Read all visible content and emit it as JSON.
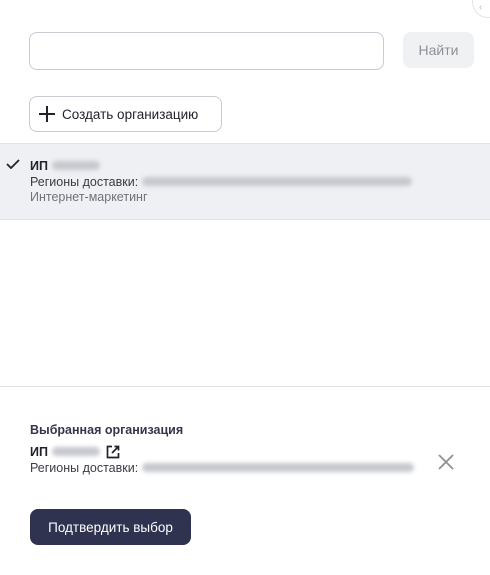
{
  "search": {
    "value": "",
    "placeholder": "",
    "button_label": "Найти"
  },
  "create_button_label": "Создать организацию",
  "organizations": [
    {
      "name_prefix": "ИП",
      "regions_label": "Регионы доставки:",
      "category": "Интернет-маркетинг",
      "selected": true
    }
  ],
  "selected_section": {
    "title": "Выбранная организация",
    "name_prefix": "ИП",
    "regions_label": "Регионы доставки:"
  },
  "confirm_button_label": "Подтвердить выбор",
  "colors": {
    "accent": "#2f3350",
    "selected_row_bg": "#eef0f3",
    "border": "#c9cbd2"
  },
  "icons": {
    "plus": "plus-icon",
    "check": "check-icon",
    "external_link": "external-link-icon",
    "close": "close-icon"
  }
}
